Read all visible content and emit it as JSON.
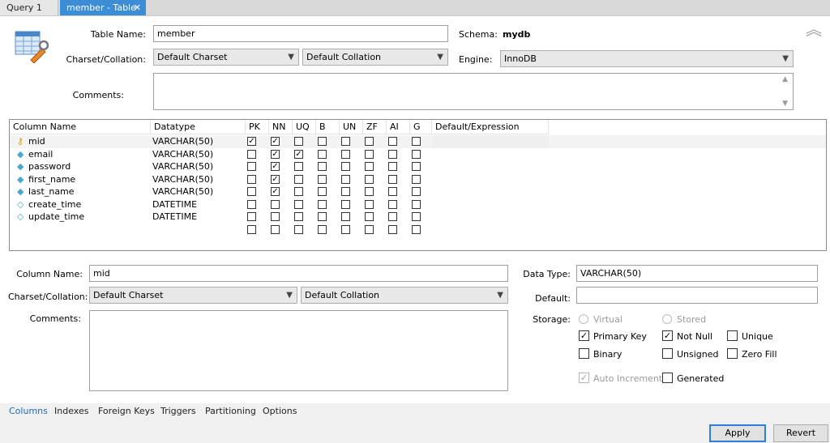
{
  "tabs": [
    {
      "label": "Query 1"
    },
    {
      "label": "member - Table"
    }
  ],
  "table": {
    "name_label": "Table Name:",
    "name_value": "member",
    "charset_label": "Charset/Collation:",
    "charset_value": "Default Charset",
    "collation_value": "Default Collation",
    "comments_label": "Comments:",
    "schema_label": "Schema:",
    "schema_value": "mydb",
    "engine_label": "Engine:",
    "engine_value": "InnoDB"
  },
  "grid": {
    "headers": [
      "Column Name",
      "Datatype",
      "PK",
      "NN",
      "UQ",
      "B",
      "UN",
      "ZF",
      "AI",
      "G",
      "Default/Expression"
    ],
    "rows": [
      {
        "icon": "key-icon",
        "name": "mid",
        "type": "VARCHAR(50)",
        "flags": [
          true,
          true,
          false,
          false,
          false,
          false,
          false,
          false
        ]
      },
      {
        "icon": "diamond-filled-icon",
        "name": "email",
        "type": "VARCHAR(50)",
        "flags": [
          false,
          true,
          true,
          false,
          false,
          false,
          false,
          false
        ]
      },
      {
        "icon": "diamond-filled-icon",
        "name": "password",
        "type": "VARCHAR(50)",
        "flags": [
          false,
          true,
          false,
          false,
          false,
          false,
          false,
          false
        ]
      },
      {
        "icon": "diamond-filled-icon",
        "name": "first_name",
        "type": "VARCHAR(50)",
        "flags": [
          false,
          true,
          false,
          false,
          false,
          false,
          false,
          false
        ]
      },
      {
        "icon": "diamond-filled-icon",
        "name": "last_name",
        "type": "VARCHAR(50)",
        "flags": [
          false,
          true,
          false,
          false,
          false,
          false,
          false,
          false
        ]
      },
      {
        "icon": "diamond-outline-icon",
        "name": "create_time",
        "type": "DATETIME",
        "flags": [
          false,
          false,
          false,
          false,
          false,
          false,
          false,
          false
        ]
      },
      {
        "icon": "diamond-outline-icon",
        "name": "update_time",
        "type": "DATETIME",
        "flags": [
          false,
          false,
          false,
          false,
          false,
          false,
          false,
          false
        ]
      },
      {
        "icon": "",
        "name": "",
        "type": "",
        "flags": [
          false,
          false,
          false,
          false,
          false,
          false,
          false,
          false
        ]
      }
    ]
  },
  "column": {
    "name_label": "Column Name:",
    "name_value": "mid",
    "charset_label": "Charset/Collation:",
    "charset_value": "Default Charset",
    "collation_value": "Default Collation",
    "comments_label": "Comments:",
    "datatype_label": "Data Type:",
    "datatype_value": "VARCHAR(50)",
    "default_label": "Default:",
    "default_value": "",
    "storage_label": "Storage:",
    "virtual_label": "Virtual",
    "stored_label": "Stored",
    "options": [
      {
        "label": "Primary Key",
        "checked": true
      },
      {
        "label": "Not Null",
        "checked": true
      },
      {
        "label": "Unique",
        "checked": false
      },
      {
        "label": "Binary",
        "checked": false
      },
      {
        "label": "Unsigned",
        "checked": false
      },
      {
        "label": "Zero Fill",
        "checked": false
      },
      {
        "label": "Auto Increment",
        "checked": true
      },
      {
        "label": "Generated",
        "checked": false
      }
    ]
  },
  "bottom_tabs": [
    "Columns",
    "Indexes",
    "Foreign Keys",
    "Triggers",
    "Partitioning",
    "Options"
  ],
  "buttons": {
    "apply": "Apply",
    "revert": "Revert"
  },
  "colors": {
    "accent": "#3c8dd6",
    "active_tab_text": "#1e6bb8"
  }
}
